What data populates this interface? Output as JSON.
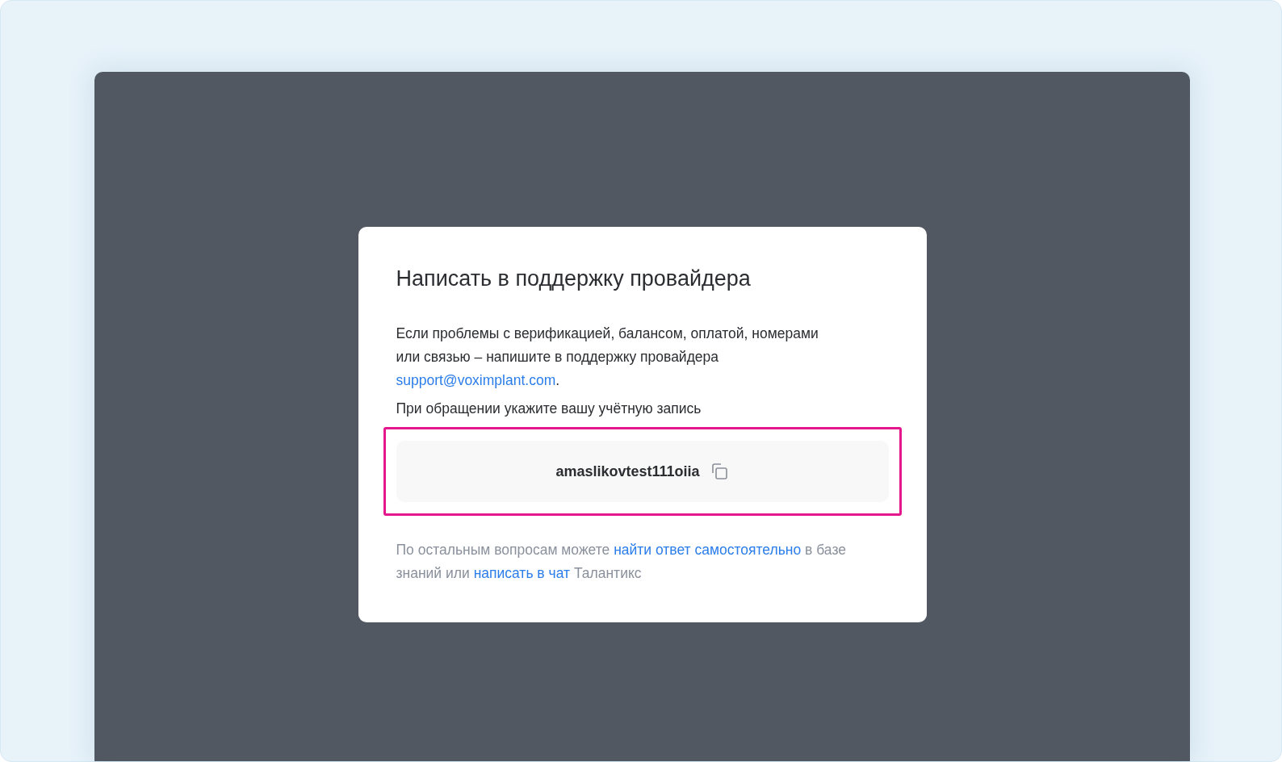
{
  "dialog": {
    "title": "Написать в поддержку провайдера",
    "message": [
      {
        "kind": "text",
        "text": "Если проблемы с верификацией, балансом, оплатой, номерами или связью – напишите в поддержку провайдера "
      },
      {
        "kind": "link",
        "text": "support@voximplant.com"
      },
      {
        "kind": "text",
        "text": "."
      }
    ],
    "account_prompt": "При обращении укажите вашу учётную запись",
    "account": {
      "value": "amaslikovtest111oiia",
      "highlighted": true
    },
    "footer": [
      {
        "kind": "text",
        "text": "По остальным вопросам можете "
      },
      {
        "kind": "link",
        "text": "найти ответ самостоятельно"
      },
      {
        "kind": "text",
        "text": " в базе знаний или "
      },
      {
        "kind": "link",
        "text": "написать в чат"
      },
      {
        "kind": "text",
        "text": " Талантикс"
      }
    ]
  }
}
